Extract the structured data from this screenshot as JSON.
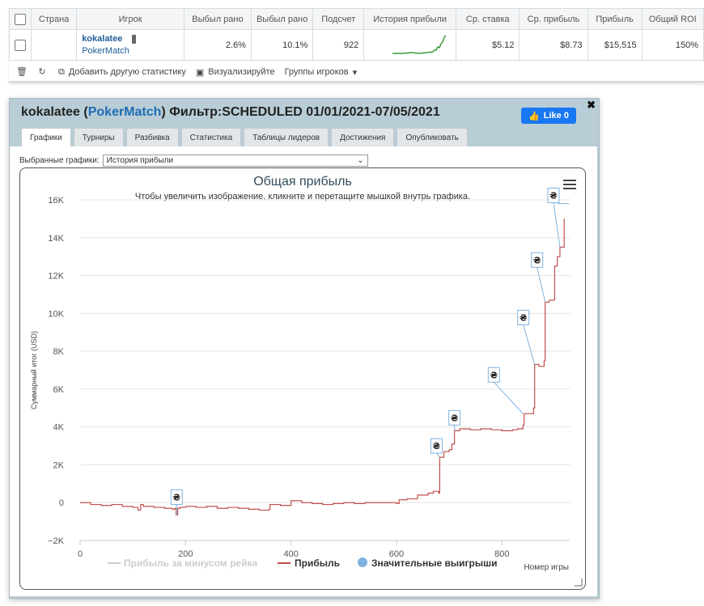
{
  "table": {
    "headers": [
      "Страна",
      "Игрок",
      "Выбыл рано",
      "Выбыл рано",
      "Подсчет",
      "История прибыли",
      "Ср. ставка",
      "Ср. прибыль",
      "Прибыль",
      "Общий ROI"
    ],
    "row": {
      "player_name": "kokalatee",
      "player_site": "PokerMatch",
      "early_exit_1": "2.6%",
      "early_exit_2": "10.1%",
      "count": "922",
      "avg_stake": "$5.12",
      "avg_profit": "$8.73",
      "profit": "$15,515",
      "roi": "150%"
    },
    "sparkline_color": "#3a9b3a"
  },
  "toolbar": {
    "add_stat_label": "Добавить другую статистику",
    "visualize_label": "Визуализируйте",
    "groups_label": "Группы игроков"
  },
  "panel": {
    "title_player": "kokalatee",
    "title_open": "(",
    "title_site": "PokerMatch",
    "title_close": ")",
    "title_filter": "Фильтр:SCHEDULED 01/01/2021-07/05/2021",
    "fb_like": "Like 0",
    "tabs": [
      "Графики",
      "Турниры",
      "Разбивка",
      "Статистика",
      "Таблицы лидеров",
      "Достижения",
      "Опубликовать"
    ],
    "select_label": "Выбранные графики:",
    "select_value": "История прибыли"
  },
  "colors": {
    "profit_line": "#c0504d",
    "rake_line": "#cccccc",
    "big_wins": "#7fb3e0",
    "title": "#334b5c"
  },
  "chart_data": {
    "type": "line",
    "title": "Общая прибыль",
    "subtitle": "Чтобы увеличить изображение, кликните и перетащите мышкой внутрь графика.",
    "xlabel": "Номер игры",
    "ylabel": "Суммарный итог (USD)",
    "xlim": [
      0,
      930
    ],
    "ylim": [
      -2000,
      16000
    ],
    "x_ticks": [
      "0",
      "200",
      "400",
      "600",
      "800"
    ],
    "y_ticks": [
      "16K",
      "14K",
      "12K",
      "10K",
      "8K",
      "6K",
      "4K",
      "2K",
      "0",
      "−2K"
    ],
    "legend": [
      "Прибыль за минусом рейка",
      "Прибыль",
      "Значительные выигрыши"
    ],
    "legend_position": "bottom",
    "grid": true,
    "series": [
      {
        "name": "Прибыль",
        "x": [
          0,
          20,
          40,
          60,
          80,
          100,
          110,
          115,
          120,
          140,
          160,
          175,
          180,
          182,
          185,
          190,
          200,
          220,
          240,
          260,
          280,
          300,
          320,
          340,
          358,
          360,
          380,
          400,
          420,
          440,
          460,
          480,
          500,
          520,
          540,
          560,
          580,
          600,
          605,
          620,
          640,
          660,
          670,
          680,
          682,
          690,
          700,
          705,
          710,
          720,
          740,
          760,
          780,
          800,
          820,
          830,
          840,
          842,
          850,
          860,
          862,
          870,
          880,
          882,
          890,
          900,
          905,
          910,
          918
        ],
        "y": [
          0,
          -100,
          -150,
          -100,
          -200,
          -250,
          -400,
          -100,
          -200,
          -250,
          -300,
          -350,
          -300,
          -650,
          -300,
          -250,
          -200,
          -250,
          -200,
          -300,
          -250,
          -300,
          -350,
          -400,
          -350,
          -100,
          -150,
          100,
          0,
          -50,
          -100,
          -50,
          0,
          -50,
          0,
          0,
          0,
          -50,
          150,
          200,
          400,
          500,
          600,
          500,
          2400,
          2700,
          2800,
          3100,
          3800,
          3900,
          3850,
          3900,
          3850,
          3800,
          3850,
          3900,
          4100,
          4700,
          4700,
          5000,
          7300,
          7200,
          7500,
          10600,
          10700,
          12500,
          13000,
          13500,
          15000
        ]
      },
      {
        "name": "Значительные выигрыши",
        "x": [
          183,
          682,
          710,
          840,
          862,
          882,
          910
        ],
        "y": [
          -650,
          2400,
          3800,
          4700,
          7300,
          10600,
          13500
        ]
      }
    ]
  }
}
